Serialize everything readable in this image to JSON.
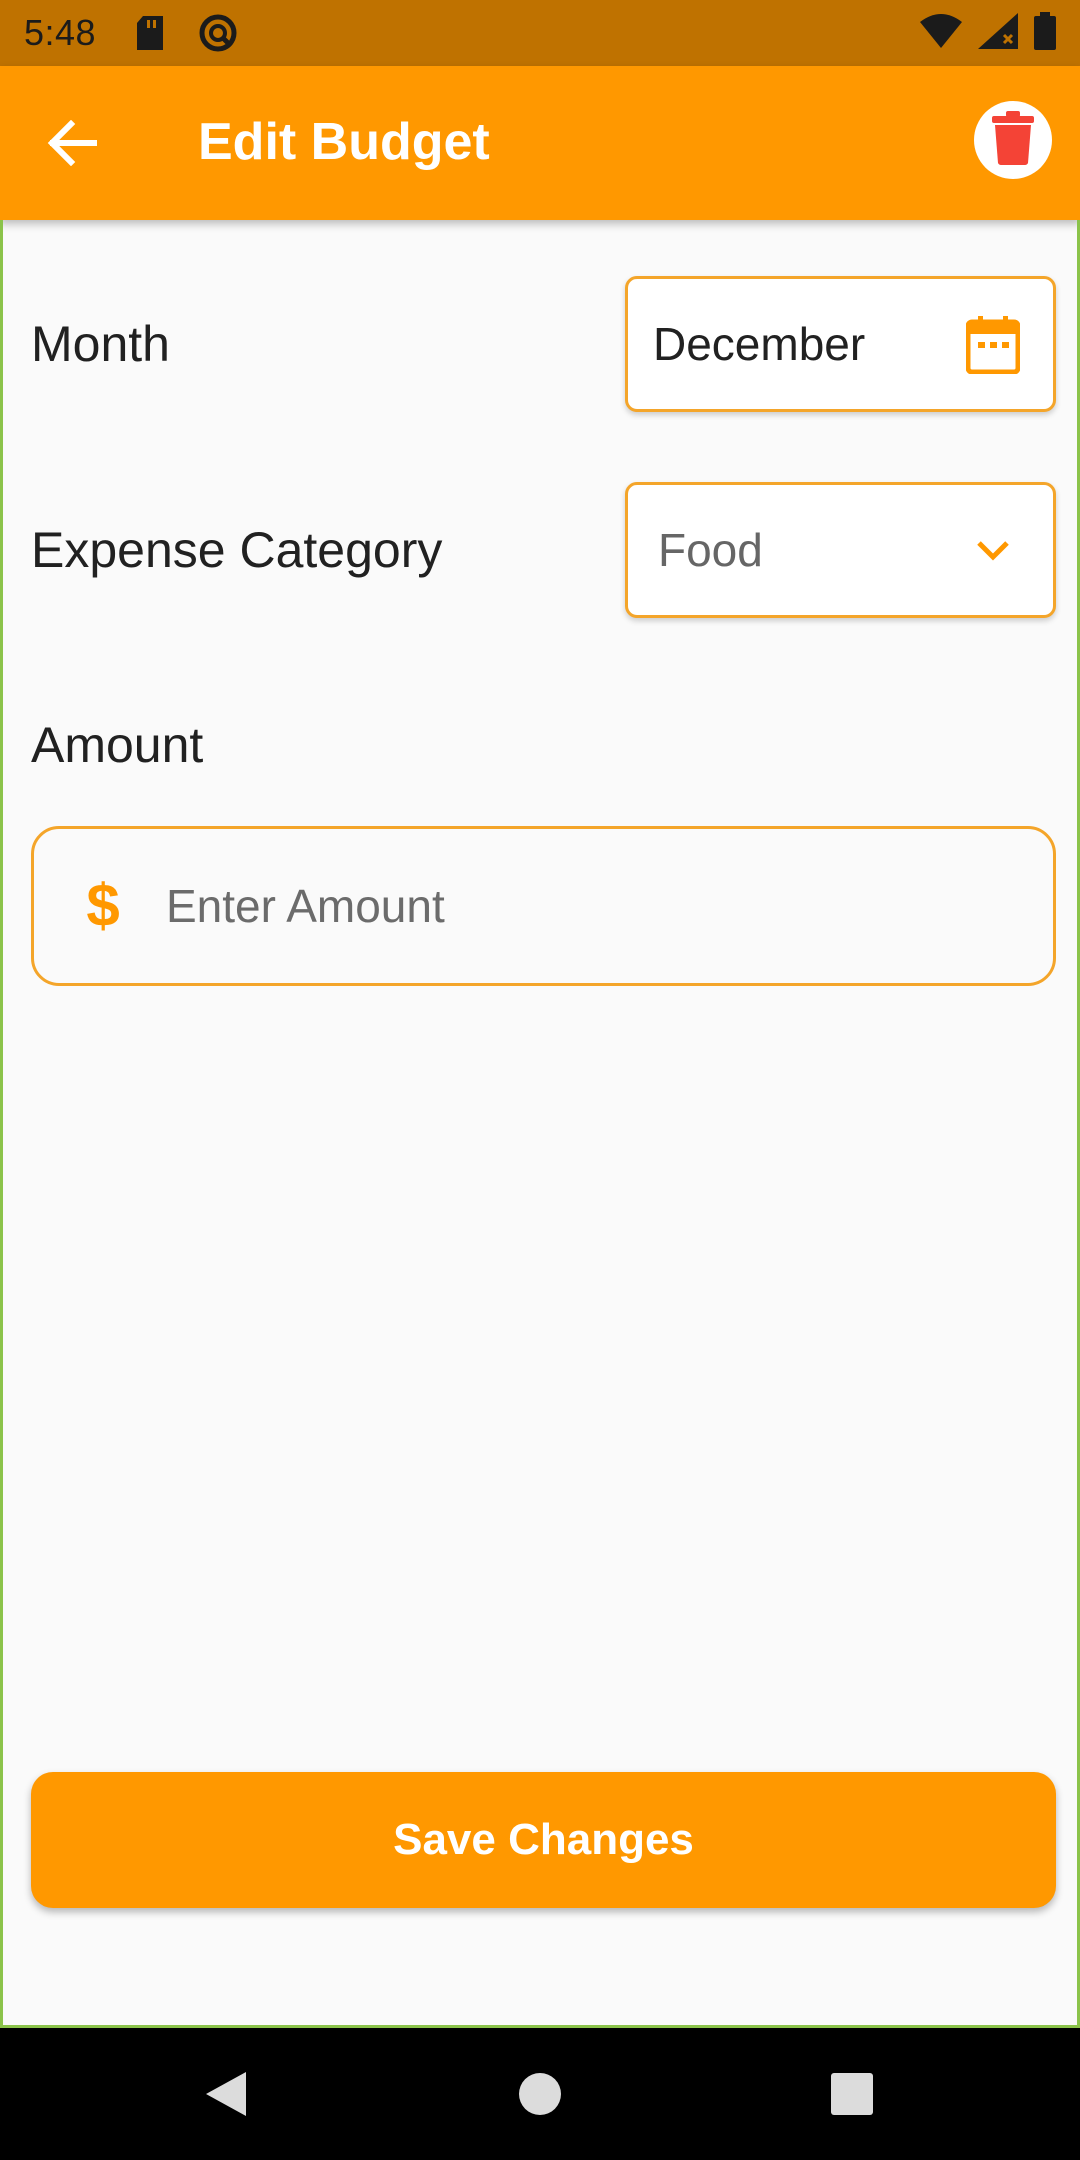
{
  "status_bar": {
    "time": "5:48",
    "icons": [
      "sd-card-icon",
      "notification-icon",
      "wifi-icon",
      "signal-icon",
      "battery-icon"
    ]
  },
  "app_bar": {
    "title": "Edit Budget",
    "back_icon": "arrow-left-icon",
    "delete_icon": "trash-icon"
  },
  "form": {
    "month": {
      "label": "Month",
      "value": "December",
      "icon": "calendar-icon"
    },
    "category": {
      "label": "Expense Category",
      "selected": "Food",
      "icon": "chevron-down-icon"
    },
    "amount": {
      "label": "Amount",
      "placeholder": "Enter Amount",
      "value": "",
      "icon": "dollar-icon",
      "icon_glyph": "$"
    }
  },
  "actions": {
    "save_label": "Save Changes"
  },
  "colors": {
    "accent": "#ff9800",
    "status_bar": "#bf7200",
    "field_border": "#f4a52a",
    "delete": "#f44336",
    "background": "#fafafa"
  }
}
